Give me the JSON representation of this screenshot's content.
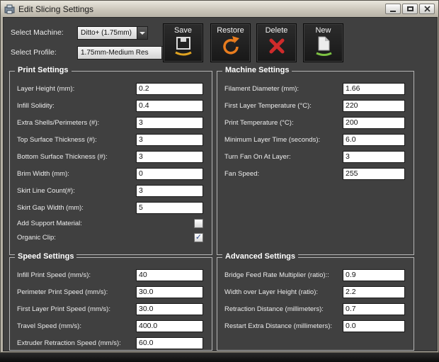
{
  "window": {
    "title": "Edit Slicing Settings"
  },
  "selectors": {
    "machine_label": "Select Machine:",
    "machine_value": "Ditto+ (1.75mm)",
    "profile_label": "Select Profile:",
    "profile_value": "1.75mm-Medium Res"
  },
  "toolbar": {
    "save": "Save",
    "restore": "Restore",
    "delete": "Delete",
    "new": "New"
  },
  "colors": {
    "save_accent": "#dfa321",
    "restore_accent": "#e87c1e",
    "delete_accent": "#cf2b2b",
    "new_accent": "#7dc242"
  },
  "groups": {
    "print": {
      "title": "Print Settings",
      "fields": [
        {
          "label": "Layer Height (mm):",
          "value": "0.2"
        },
        {
          "label": "Infill Solidity:",
          "value": "0.4"
        },
        {
          "label": "Extra Shells/Perimeters (#):",
          "value": "3"
        },
        {
          "label": "Top Surface Thickness (#):",
          "value": "3"
        },
        {
          "label": "Bottom Surface Thickness (#):",
          "value": "3"
        },
        {
          "label": "Brim Width (mm):",
          "value": "0"
        },
        {
          "label": "Skirt Line Count(#):",
          "value": "3"
        },
        {
          "label": "Skirt Gap Width (mm):",
          "value": "5"
        }
      ],
      "checkboxes": [
        {
          "label": "Add Support Material:",
          "checked": false,
          "glyph": ""
        },
        {
          "label": "Organic Clip:",
          "checked": true,
          "glyph": "✓"
        }
      ]
    },
    "machine": {
      "title": "Machine Settings",
      "fields": [
        {
          "label": "Filament Diameter (mm):",
          "value": "1.66"
        },
        {
          "label": "First Layer Temperature (°C):",
          "value": "220"
        },
        {
          "label": "Print Temperature (°C):",
          "value": "200"
        },
        {
          "label": "Minimum Layer Time (seconds):",
          "value": "6.0"
        },
        {
          "label": "Turn Fan On At Layer:",
          "value": "3"
        },
        {
          "label": "Fan Speed:",
          "value": "255"
        }
      ]
    },
    "speed": {
      "title": "Speed Settings",
      "fields": [
        {
          "label": "Infill Print Speed (mm/s):",
          "value": "40"
        },
        {
          "label": "Perimeter Print Speed (mm/s):",
          "value": "30.0"
        },
        {
          "label": "First Layer Print Speed (mm/s):",
          "value": "30.0"
        },
        {
          "label": "Travel Speed (mm/s):",
          "value": "400.0"
        },
        {
          "label": "Extruder Retraction Speed (mm/s):",
          "value": "60.0"
        }
      ]
    },
    "advanced": {
      "title": "Advanced Settings",
      "fields": [
        {
          "label": "Bridge Feed Rate Multiplier (ratio)::",
          "value": "0.9"
        },
        {
          "label": "Width over Layer Height (ratio):",
          "value": "2.2"
        },
        {
          "label": "Retraction Distance (millimeters):",
          "value": "0.7"
        },
        {
          "label": "Restart Extra Distance (millimeters):",
          "value": "0.0"
        }
      ]
    }
  }
}
